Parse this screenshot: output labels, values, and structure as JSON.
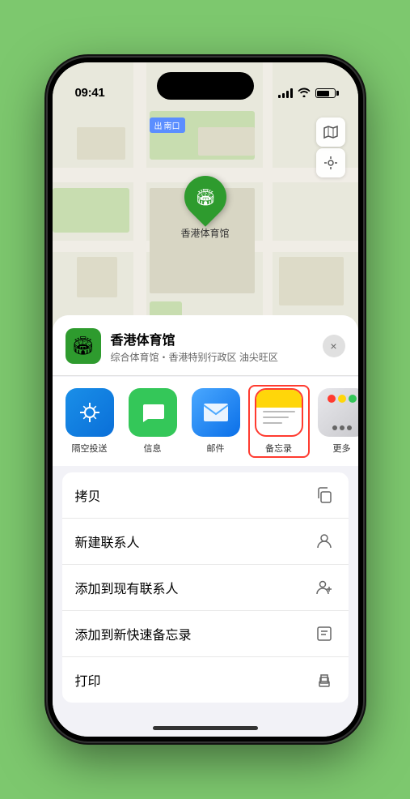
{
  "status_bar": {
    "time": "09:41",
    "location_arrow": "▶"
  },
  "map": {
    "label_text": "南口",
    "label_prefix": "出",
    "pin_label": "香港体育馆"
  },
  "venue": {
    "name": "香港体育馆",
    "description": "综合体育馆・香港特别行政区 油尖旺区",
    "icon": "🏟"
  },
  "share_items": [
    {
      "id": "airdrop",
      "label": "隔空投送",
      "type": "airdrop"
    },
    {
      "id": "messages",
      "label": "信息",
      "type": "messages"
    },
    {
      "id": "mail",
      "label": "邮件",
      "type": "mail"
    },
    {
      "id": "notes",
      "label": "备忘录",
      "type": "notes"
    },
    {
      "id": "more",
      "label": "更多",
      "type": "more"
    }
  ],
  "actions": [
    {
      "id": "copy",
      "label": "拷贝",
      "icon": "copy"
    },
    {
      "id": "new-contact",
      "label": "新建联系人",
      "icon": "person"
    },
    {
      "id": "add-contact",
      "label": "添加到现有联系人",
      "icon": "person-add"
    },
    {
      "id": "quick-note",
      "label": "添加到新快速备忘录",
      "icon": "note"
    },
    {
      "id": "print",
      "label": "打印",
      "icon": "print"
    }
  ],
  "close_button_label": "×"
}
